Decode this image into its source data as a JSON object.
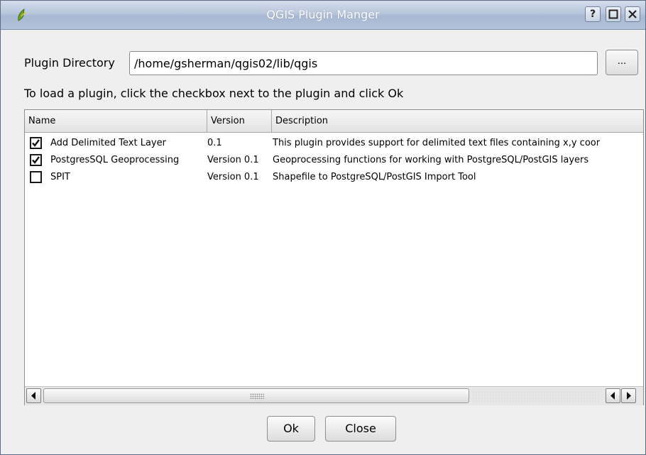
{
  "window": {
    "title": "QGIS Plugin Manger",
    "help_label": "?",
    "maximize_label": "□",
    "close_label": "✕",
    "icon": "qgis-logo-icon"
  },
  "directory": {
    "label": "Plugin Directory",
    "value": "/home/gsherman/qgis02/lib/qgis",
    "browse_label": "..."
  },
  "instructions": "To load a plugin, click the checkbox next to the plugin and click Ok",
  "table": {
    "columns": [
      "Name",
      "Version",
      "Description"
    ],
    "rows": [
      {
        "checked": true,
        "name": "Add Delimited Text Layer",
        "version": "0.1",
        "description": "This plugin provides support for delimited text files containing x,y coor"
      },
      {
        "checked": true,
        "name": "PostgresSQL Geoprocessing",
        "version": "Version 0.1",
        "description": "Geoprocessing functions for working with PostgreSQL/PostGIS layers"
      },
      {
        "checked": false,
        "name": "SPIT",
        "version": "Version 0.1",
        "description": "Shapefile to PostgreSQL/PostGIS Import Tool"
      }
    ]
  },
  "buttons": {
    "ok_label": "Ok",
    "close_label": "Close"
  }
}
